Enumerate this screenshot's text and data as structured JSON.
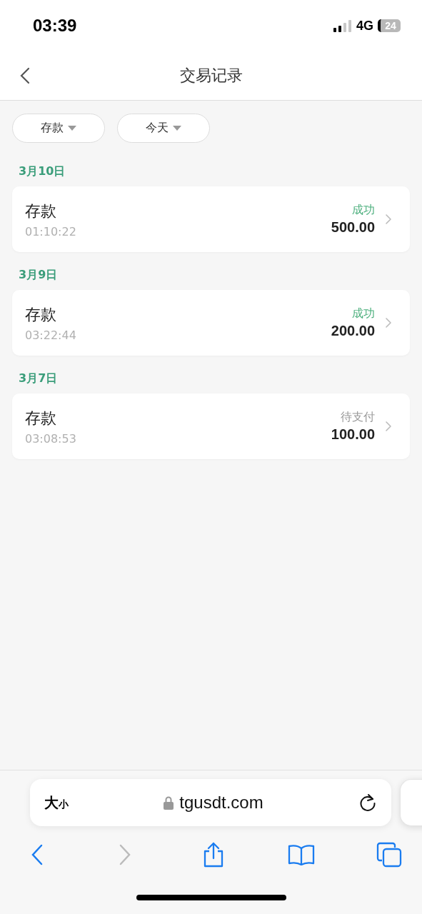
{
  "status_bar": {
    "time": "03:39",
    "network": "4G",
    "battery": "24"
  },
  "header": {
    "title": "交易记录"
  },
  "filters": [
    {
      "label": "存款"
    },
    {
      "label": "今天"
    }
  ],
  "groups": [
    {
      "date": "3月10日",
      "records": [
        {
          "type": "存款",
          "time": "01:10:22",
          "status": "成功",
          "pending": false,
          "amount": "500.00"
        }
      ]
    },
    {
      "date": "3月9日",
      "records": [
        {
          "type": "存款",
          "time": "03:22:44",
          "status": "成功",
          "pending": false,
          "amount": "200.00"
        }
      ]
    },
    {
      "date": "3月7日",
      "records": [
        {
          "type": "存款",
          "time": "03:08:53",
          "status": "待支付",
          "pending": true,
          "amount": "100.00"
        }
      ]
    }
  ],
  "browser": {
    "format_large": "大",
    "format_small": "小",
    "url": "tgusdt.com",
    "back_disabled": false,
    "forward_disabled": true
  }
}
